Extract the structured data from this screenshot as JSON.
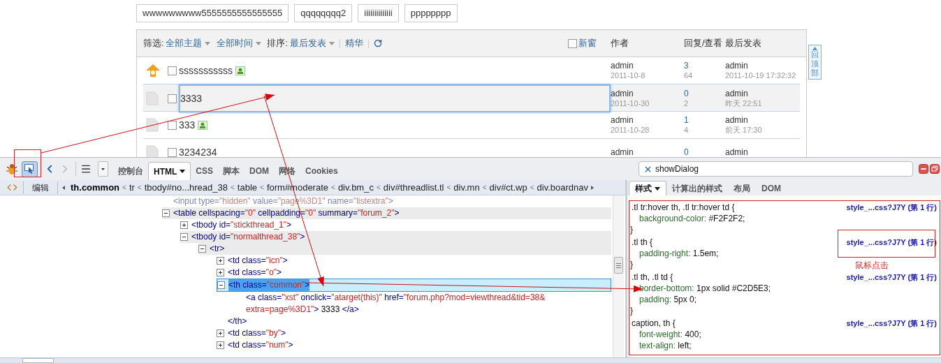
{
  "tag_buttons": [
    "wwwwwwwww5555555555555555",
    "qqqqqqqq2",
    "iiiiiiiiiiiiii",
    "pppppppp"
  ],
  "filter_bar": {
    "filter_label": "筛选:",
    "filters": [
      {
        "label": "全部主题",
        "dropdown": true
      },
      {
        "label": "全部时间",
        "dropdown": true
      }
    ],
    "sort_label": "排序:",
    "sort": {
      "label": "最后发表",
      "dropdown": true
    },
    "digest": "精华",
    "new_window": {
      "label": "新窗",
      "checked": false
    }
  },
  "columns": [
    "作者",
    "回复/查看",
    "最后发表"
  ],
  "threads": [
    {
      "kind": "pinned",
      "title": "sssssssssss",
      "checked": false,
      "has_image": true,
      "selected": false,
      "author": "admin",
      "date": "2011-10-8",
      "replies": "3",
      "views": "64",
      "last_author": "admin",
      "last_time": "2011-10-19 17:32:32"
    },
    {
      "kind": "normal",
      "title": "3333",
      "checked": false,
      "has_image": false,
      "selected": true,
      "author": "admin",
      "date": "2011-10-30",
      "replies": "0",
      "views": "2",
      "last_author": "admin",
      "last_time": "昨天 22:51"
    },
    {
      "kind": "normal",
      "title": "333",
      "checked": false,
      "has_image": true,
      "selected": false,
      "author": "admin",
      "date": "2011-10-28",
      "replies": "1",
      "views": "4",
      "last_author": "admin",
      "last_time": "前天 17:30"
    },
    {
      "kind": "normal",
      "title": "3234234",
      "checked": false,
      "has_image": false,
      "selected": false,
      "author": "admin",
      "replies": "0",
      "last_author": "admin"
    }
  ],
  "back_to_top": "回顶部",
  "firebug": {
    "inspect_on": true,
    "tabs": [
      {
        "label": "控制台",
        "selected": false,
        "dropdown": false
      },
      {
        "label": "HTML",
        "selected": true,
        "dropdown": true
      },
      {
        "label": "CSS",
        "selected": false,
        "dropdown": false
      },
      {
        "label": "脚本",
        "selected": false,
        "dropdown": false
      },
      {
        "label": "DOM",
        "selected": false,
        "dropdown": false
      },
      {
        "label": "网络",
        "selected": false,
        "dropdown": false
      },
      {
        "label": "Cookies",
        "selected": false,
        "dropdown": false
      }
    ],
    "search": {
      "value": "showDialog"
    },
    "breadcrumb": {
      "edit": "编辑",
      "separator": "<",
      "items": [
        {
          "label": "th.common",
          "selected": true
        },
        {
          "label": "tr",
          "selected": false
        },
        {
          "label": "tbody#no...hread_38",
          "selected": false
        },
        {
          "label": "table",
          "selected": false
        },
        {
          "label": "form#moderate",
          "selected": false
        },
        {
          "label": "div.bm_c",
          "selected": false
        },
        {
          "label": "div#threadlist.tl",
          "selected": false
        },
        {
          "label": "div.mn",
          "selected": false
        },
        {
          "label": "div#ct.wp",
          "selected": false
        },
        {
          "label": "div.boardnav",
          "selected": false
        }
      ]
    },
    "html_tree": [
      {
        "faded": true,
        "selected": false,
        "segments": [
          {
            "kind": "tag",
            "text": "<input"
          },
          {
            "kind": "attr",
            "text": " type="
          },
          {
            "kind": "value",
            "text": "\"hidden\""
          },
          {
            "kind": "attr",
            "text": " value="
          },
          {
            "kind": "value",
            "text": "\"page%3D1\""
          },
          {
            "kind": "attr",
            "text": " name="
          },
          {
            "kind": "value",
            "text": "\"listextra\""
          },
          {
            "kind": "tag",
            "text": ">"
          }
        ]
      },
      {
        "expanded": true,
        "selected": false,
        "segments": [
          {
            "kind": "tag",
            "text": "<table"
          },
          {
            "kind": "attr",
            "text": " cellspacing="
          },
          {
            "kind": "value",
            "text": "\"0\""
          },
          {
            "kind": "attr",
            "text": " cellpadding="
          },
          {
            "kind": "value",
            "text": "\"0\""
          },
          {
            "kind": "attr",
            "text": " summary="
          },
          {
            "kind": "value",
            "text": "\"forum_2\""
          },
          {
            "kind": "tag",
            "text": ">"
          }
        ],
        "children": [
          {
            "expanded": false,
            "selected": false,
            "segments": [
              {
                "kind": "tag",
                "text": "<tbody"
              },
              {
                "kind": "attr",
                "text": " id="
              },
              {
                "kind": "value",
                "text": "\"stickthread_1\""
              },
              {
                "kind": "tag",
                "text": ">"
              }
            ]
          },
          {
            "expanded": true,
            "selected": false,
            "segments": [
              {
                "kind": "tag",
                "text": "<tbody"
              },
              {
                "kind": "attr",
                "text": " id="
              },
              {
                "kind": "value",
                "text": "\"normalthread_38\""
              },
              {
                "kind": "tag",
                "text": ">"
              }
            ],
            "children": [
              {
                "expanded": true,
                "selected": false,
                "segments": [
                  {
                    "kind": "tag",
                    "text": "<tr>"
                  }
                ],
                "children": [
                  {
                    "expanded": false,
                    "selected": false,
                    "segments": [
                      {
                        "kind": "tag",
                        "text": "<td"
                      },
                      {
                        "kind": "attr",
                        "text": " class="
                      },
                      {
                        "kind": "value",
                        "text": "\"icn\""
                      },
                      {
                        "kind": "tag",
                        "text": ">"
                      }
                    ]
                  },
                  {
                    "expanded": false,
                    "selected": false,
                    "segments": [
                      {
                        "kind": "tag",
                        "text": "<td"
                      },
                      {
                        "kind": "attr",
                        "text": " class="
                      },
                      {
                        "kind": "value",
                        "text": "\"o\""
                      },
                      {
                        "kind": "tag",
                        "text": ">"
                      }
                    ]
                  },
                  {
                    "expanded": true,
                    "selected": true,
                    "segments": [
                      {
                        "kind": "tag",
                        "text": "<th"
                      },
                      {
                        "kind": "attr",
                        "text": " class="
                      },
                      {
                        "kind": "value",
                        "text": "\"common\""
                      },
                      {
                        "kind": "tag",
                        "text": ">"
                      }
                    ],
                    "close": [
                      {
                        "kind": "tag",
                        "text": "</th>"
                      }
                    ],
                    "children": [
                      {
                        "selected": false,
                        "segments": [
                          {
                            "kind": "tag",
                            "text": "<a"
                          },
                          {
                            "kind": "attr",
                            "text": " class="
                          },
                          {
                            "kind": "value",
                            "text": "\"xst\""
                          },
                          {
                            "kind": "attr",
                            "text": " onclick="
                          },
                          {
                            "kind": "value",
                            "text": "\"atarget(this)\""
                          },
                          {
                            "kind": "attr",
                            "text": " href="
                          },
                          {
                            "kind": "value",
                            "text": "\"forum.php?mod=viewthread&tid=38&"
                          }
                        ],
                        "wrap": [
                          {
                            "kind": "value",
                            "text": "extra=page%3D1\""
                          },
                          {
                            "kind": "tag",
                            "text": ">"
                          },
                          {
                            "kind": "text",
                            "text": " 3333 "
                          },
                          {
                            "kind": "tag",
                            "text": "</a>"
                          }
                        ]
                      }
                    ]
                  },
                  {
                    "expanded": false,
                    "selected": false,
                    "segments": [
                      {
                        "kind": "tag",
                        "text": "<td"
                      },
                      {
                        "kind": "attr",
                        "text": " class="
                      },
                      {
                        "kind": "value",
                        "text": "\"by\""
                      },
                      {
                        "kind": "tag",
                        "text": ">"
                      }
                    ]
                  },
                  {
                    "expanded": false,
                    "selected": false,
                    "segments": [
                      {
                        "kind": "tag",
                        "text": "<td"
                      },
                      {
                        "kind": "attr",
                        "text": " class="
                      },
                      {
                        "kind": "value",
                        "text": "\"num\""
                      },
                      {
                        "kind": "tag",
                        "text": ">"
                      }
                    ]
                  }
                ]
              }
            ]
          }
        ]
      }
    ],
    "side_tabs": [
      {
        "label": "样式",
        "selected": true,
        "dropdown": true
      },
      {
        "label": "计算出的样式",
        "selected": false,
        "dropdown": false
      },
      {
        "label": "布局",
        "selected": false,
        "dropdown": false
      },
      {
        "label": "DOM",
        "selected": false,
        "dropdown": false
      }
    ],
    "css_rules": [
      {
        "selector": ".tl tr:hover th, .tl tr:hover td {",
        "source": "style_...css?J7Y (第 1 行)",
        "declarations": [
          {
            "property": "background-color:",
            "value": " #F2F2F2;"
          }
        ],
        "close": "}"
      },
      {
        "selector": ".tl th {",
        "source": "style_...css?J7Y (第 1 行)",
        "declarations": [
          {
            "property": "padding-right:",
            "value": " 1.5em;"
          }
        ],
        "close": "}"
      },
      {
        "selector": ".tl th, .tl td {",
        "source": "style_...css?J7Y (第 1 行)",
        "declarations": [
          {
            "property": "border-bottom:",
            "value": " 1px solid #C2D5E3;"
          },
          {
            "property": "padding:",
            "value": " 5px 0;"
          }
        ],
        "close": "}"
      },
      {
        "selector": "caption, th {",
        "source": "style_...css?J7Y (第 1 行)",
        "declarations": [
          {
            "property": "font-weight:",
            "value": " 400;"
          },
          {
            "property": "text-align:",
            "value": " left;"
          }
        ]
      }
    ]
  },
  "annotation": {
    "note": "鼠标点击"
  }
}
